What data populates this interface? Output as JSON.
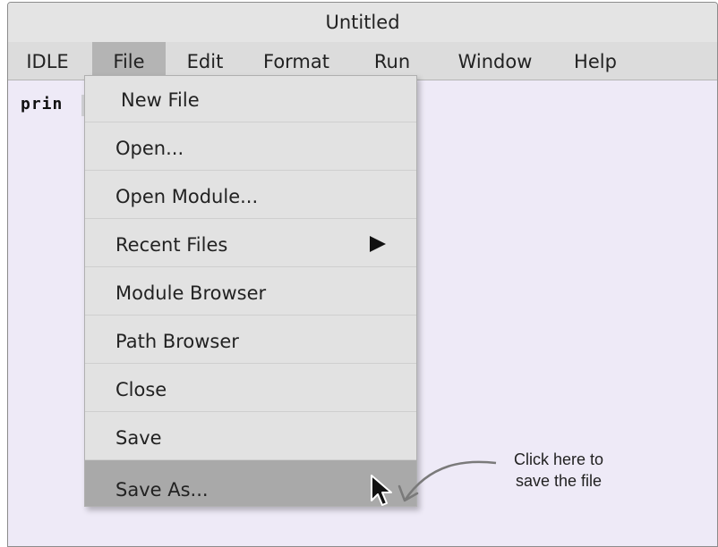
{
  "window": {
    "title": "Untitled"
  },
  "menubar": {
    "items": [
      {
        "label": "IDLE"
      },
      {
        "label": "File"
      },
      {
        "label": "Edit"
      },
      {
        "label": "Format"
      },
      {
        "label": "Run"
      },
      {
        "label": "Window"
      },
      {
        "label": "Help"
      }
    ],
    "active": "File"
  },
  "editor": {
    "code": "prin"
  },
  "file_menu": {
    "items": [
      {
        "label": "New File"
      },
      {
        "label": "Open..."
      },
      {
        "label": "Open Module..."
      },
      {
        "label": "Recent Files",
        "submenu_icon": "triangle-right-icon"
      },
      {
        "label": "Module Browser"
      },
      {
        "label": "Path Browser"
      },
      {
        "label": "Close"
      },
      {
        "label": "Save"
      },
      {
        "label": "Save As...",
        "highlighted": true
      }
    ]
  },
  "annotation": {
    "line1": "Click here to",
    "line2": "save the file",
    "arrow_icon": "curved-arrow-icon"
  },
  "cursor_icon": "mouse-pointer-icon",
  "colors": {
    "highlight": "#a9a9a9",
    "editor_bg": "#eeeaf7",
    "menubar_active": "#b4b4b4"
  }
}
